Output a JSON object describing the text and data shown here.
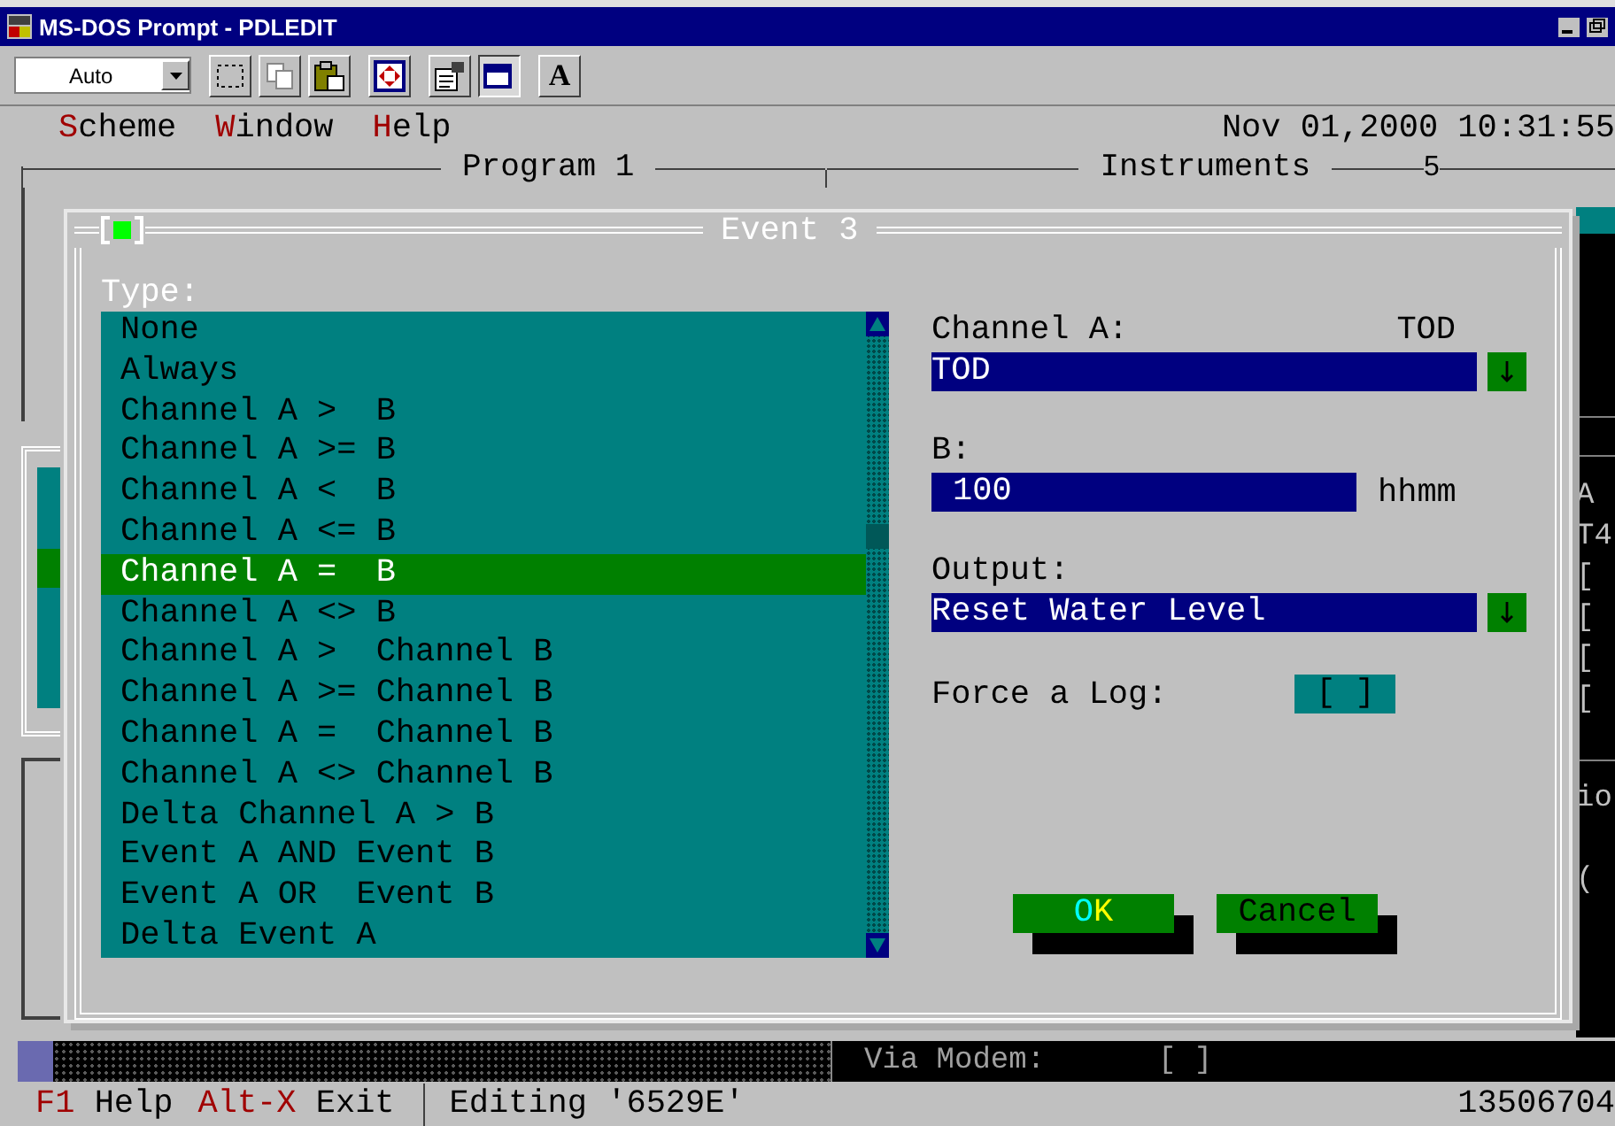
{
  "window": {
    "title": "MS-DOS Prompt - PDLEDIT"
  },
  "toolbar": {
    "font_size": "Auto",
    "font_button": "A"
  },
  "menu": [
    "Scheme",
    "Window",
    "Help"
  ],
  "clock": "Nov 01,2000 10:31:55",
  "background_titles": {
    "program": "Program 1",
    "instruments": "Instruments",
    "number": "5"
  },
  "background_fragments": {
    "upper": [
      "A",
      "T4",
      "[",
      "[",
      "[",
      "["
    ],
    "lower": [
      "io",
      "("
    ]
  },
  "dialog": {
    "title": "Event 3",
    "type_label": "Type:",
    "types": [
      {
        "label": "None",
        "selected": false
      },
      {
        "label": "Always",
        "selected": false
      },
      {
        "label": "Channel A >  B",
        "selected": false
      },
      {
        "label": "Channel A >= B",
        "selected": false
      },
      {
        "label": "Channel A <  B",
        "selected": false
      },
      {
        "label": "Channel A <= B",
        "selected": false
      },
      {
        "label": "Channel A =  B",
        "selected": true
      },
      {
        "label": "Channel A <> B",
        "selected": false
      },
      {
        "label": "Channel A >  Channel B",
        "selected": false
      },
      {
        "label": "Channel A >= Channel B",
        "selected": false
      },
      {
        "label": "Channel A =  Channel B",
        "selected": false
      },
      {
        "label": "Channel A <> Channel B",
        "selected": false
      },
      {
        "label": "Delta Channel A > B",
        "selected": false
      },
      {
        "label": "Event A AND Event B",
        "selected": false
      },
      {
        "label": "Event A OR  Event B",
        "selected": false
      },
      {
        "label": "Delta Event A",
        "selected": false
      }
    ],
    "channel_a": {
      "label": "Channel A:",
      "hint": "TOD",
      "value": "TOD"
    },
    "b": {
      "label": "B:",
      "value": "100",
      "unit": "hhmm"
    },
    "output": {
      "label": "Output:",
      "value": "Reset Water Level"
    },
    "force_log": {
      "label": "Force a Log:",
      "value": "[ ]",
      "checked": false
    },
    "buttons": [
      {
        "label": "OK",
        "focused": true
      },
      {
        "label": "Cancel",
        "focused": false
      }
    ]
  },
  "modem": {
    "label": "Via Modem:",
    "value": "[ ]",
    "checked": false
  },
  "status_bar": {
    "keys": [
      {
        "key": "F1",
        "action": "Help"
      },
      {
        "key": "Alt-X",
        "action": "Exit"
      }
    ],
    "message": "Editing '6529E'",
    "number": "13506704"
  }
}
